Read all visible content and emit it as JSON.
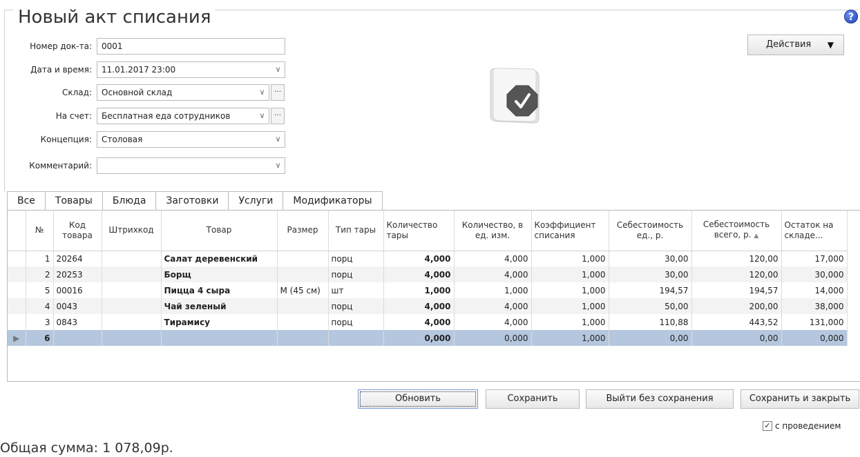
{
  "header": {
    "title": "Новый акт списания",
    "help_icon": "help-icon"
  },
  "form": {
    "doc_number_label": "Номер док-та:",
    "doc_number_value": "0001",
    "datetime_label": "Дата и время:",
    "datetime_value": "11.01.2017 23:00",
    "warehouse_label": "Склад:",
    "warehouse_value": "Основной склад",
    "account_label": "На счет:",
    "account_value": "Бесплатная еда сотрудников",
    "concept_label": "Концепция:",
    "concept_value": "Столовая",
    "comment_label": "Комментарий:",
    "comment_value": ""
  },
  "actions": {
    "label": "Действия"
  },
  "tabs": [
    "Все",
    "Товары",
    "Блюда",
    "Заготовки",
    "Услуги",
    "Модификаторы"
  ],
  "grid": {
    "columns": [
      "№",
      "Код товара",
      "Штрихкод",
      "Товар",
      "Размер",
      "Тип тары",
      "Количество тары",
      "Количество, в ед. изм.",
      "Коэффициент списания",
      "Себестоимость ед., р.",
      "Себестоимость всего, р.",
      "Остаток на складе..."
    ],
    "rows": [
      {
        "n": "1",
        "code": "20264",
        "barcode": "",
        "name": "Салат деревенский",
        "size": "",
        "pack": "порц",
        "qty_pack": "4,000",
        "qty_unit": "4,000",
        "coef": "1,000",
        "cost_unit": "30,00",
        "cost_total": "120,00",
        "stock": "17,000"
      },
      {
        "n": "2",
        "code": "20253",
        "barcode": "",
        "name": "Борщ",
        "size": "",
        "pack": "порц",
        "qty_pack": "4,000",
        "qty_unit": "4,000",
        "coef": "1,000",
        "cost_unit": "30,00",
        "cost_total": "120,00",
        "stock": "30,000"
      },
      {
        "n": "5",
        "code": "00016",
        "barcode": "",
        "name": "Пицца 4 сыра",
        "size": "M (45 см)",
        "pack": "шт",
        "qty_pack": "1,000",
        "qty_unit": "1,000",
        "coef": "1,000",
        "cost_unit": "194,57",
        "cost_total": "194,57",
        "stock": "14,000"
      },
      {
        "n": "4",
        "code": "0043",
        "barcode": "",
        "name": "Чай зеленый",
        "size": "",
        "pack": "порц",
        "qty_pack": "4,000",
        "qty_unit": "4,000",
        "coef": "1,000",
        "cost_unit": "50,00",
        "cost_total": "200,00",
        "stock": "38,000"
      },
      {
        "n": "3",
        "code": "0843",
        "barcode": "",
        "name": "Тирамису",
        "size": "",
        "pack": "порц",
        "qty_pack": "4,000",
        "qty_unit": "4,000",
        "coef": "1,000",
        "cost_unit": "110,88",
        "cost_total": "443,52",
        "stock": "131,000"
      },
      {
        "n": "6",
        "code": "",
        "barcode": "",
        "name": "",
        "size": "",
        "pack": "",
        "qty_pack": "0,000",
        "qty_unit": "0,000",
        "coef": "1,000",
        "cost_unit": "0,00",
        "cost_total": "0,00",
        "stock": "0,000"
      }
    ]
  },
  "buttons": {
    "refresh": "Обновить",
    "save": "Сохранить",
    "exit_no_save": "Выйти без сохранения",
    "save_close": "Сохранить и закрыть"
  },
  "checkbox": {
    "label": "с проведением",
    "checked": true
  },
  "footer": {
    "total": "Общая сумма: 1 078,09р."
  }
}
